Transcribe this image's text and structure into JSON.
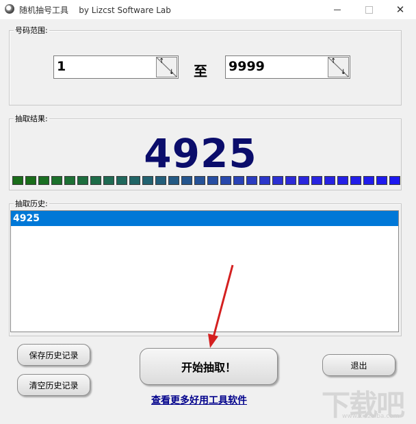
{
  "window": {
    "title": "随机抽号工具    by Lizcst Software Lab",
    "min_glyph": "–",
    "close_glyph": "✕"
  },
  "range": {
    "label": "号码范围:",
    "from_value": "1",
    "separator": "至",
    "to_value": "9999",
    "spin_up": "↑",
    "spin_down": "↓"
  },
  "result": {
    "label": "抽取结果:",
    "number": "4925",
    "progress_level": 1.0,
    "led_colors": [
      "#1a6d1a",
      "#1a6d1a",
      "#1a6f22",
      "#1b702b",
      "#1c7034",
      "#1d6e3e",
      "#1e6c48",
      "#1f6a52",
      "#20685c",
      "#216566",
      "#226270",
      "#235e7a",
      "#245a84",
      "#25568e",
      "#265298",
      "#274ea2",
      "#2848ac",
      "#2942b6",
      "#2a3cc0",
      "#2b36ca",
      "#2c30d2",
      "#2c2ad8",
      "#2a26dd",
      "#2824e0",
      "#2622e3",
      "#2420e6",
      "#221ee8",
      "#201ceb",
      "#1e1aee",
      "#1c18f0"
    ]
  },
  "history": {
    "label": "抽取历史:",
    "items": [
      "4925"
    ]
  },
  "buttons": {
    "save": "保存历史记录",
    "clear": "清空历史记录",
    "start": "开始抽取！",
    "exit": "退出"
  },
  "link_text": "查看更多好用工具软件",
  "watermark": {
    "text": "下载吧",
    "url": "www.xiazaiba.com"
  }
}
